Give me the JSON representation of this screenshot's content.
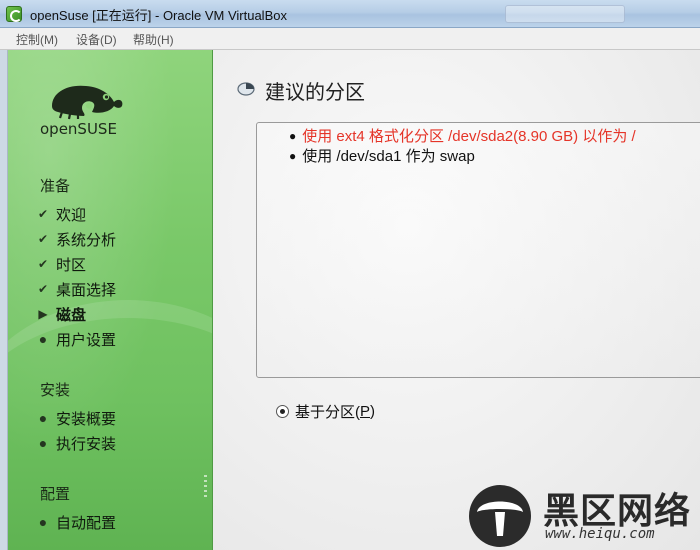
{
  "window": {
    "title": "openSuse [正在运行] - Oracle VM VirtualBox"
  },
  "menubar": {
    "items": [
      "控制(M)",
      "设备(D)",
      "帮助(H)"
    ]
  },
  "sidebar": {
    "logo_text": "openSUSE",
    "sections": [
      {
        "title": "准备",
        "items": [
          {
            "label": "欢迎",
            "state": "done",
            "icon": "check-icon"
          },
          {
            "label": "系统分析",
            "state": "done",
            "icon": "check-icon"
          },
          {
            "label": "时区",
            "state": "done",
            "icon": "check-icon"
          },
          {
            "label": "桌面选择",
            "state": "done",
            "icon": "check-icon"
          },
          {
            "label": "磁盘",
            "state": "current",
            "icon": "arrow-right-icon"
          },
          {
            "label": "用户设置",
            "state": "pending",
            "icon": "bullet-icon"
          }
        ]
      },
      {
        "title": "安装",
        "items": [
          {
            "label": "安装概要",
            "state": "pending",
            "icon": "bullet-icon"
          },
          {
            "label": "执行安装",
            "state": "pending",
            "icon": "bullet-icon"
          }
        ]
      },
      {
        "title": "配置",
        "items": [
          {
            "label": "自动配置",
            "state": "pending",
            "icon": "bullet-icon"
          }
        ]
      }
    ]
  },
  "main": {
    "title": "建议的分区",
    "proposal": [
      {
        "text": "使用 ext4 格式化分区 /dev/sda2(8.90 GB) 以作为 /",
        "color": "#e53428"
      },
      {
        "text": "使用 /dev/sda1 作为 swap",
        "color": "#111111"
      }
    ],
    "radio": {
      "label_prefix": "基于分区(",
      "label_key": "P",
      "label_suffix": ")",
      "checked": true
    }
  },
  "watermark": {
    "text": "黑区网络",
    "url": "www.heiqu.com"
  }
}
